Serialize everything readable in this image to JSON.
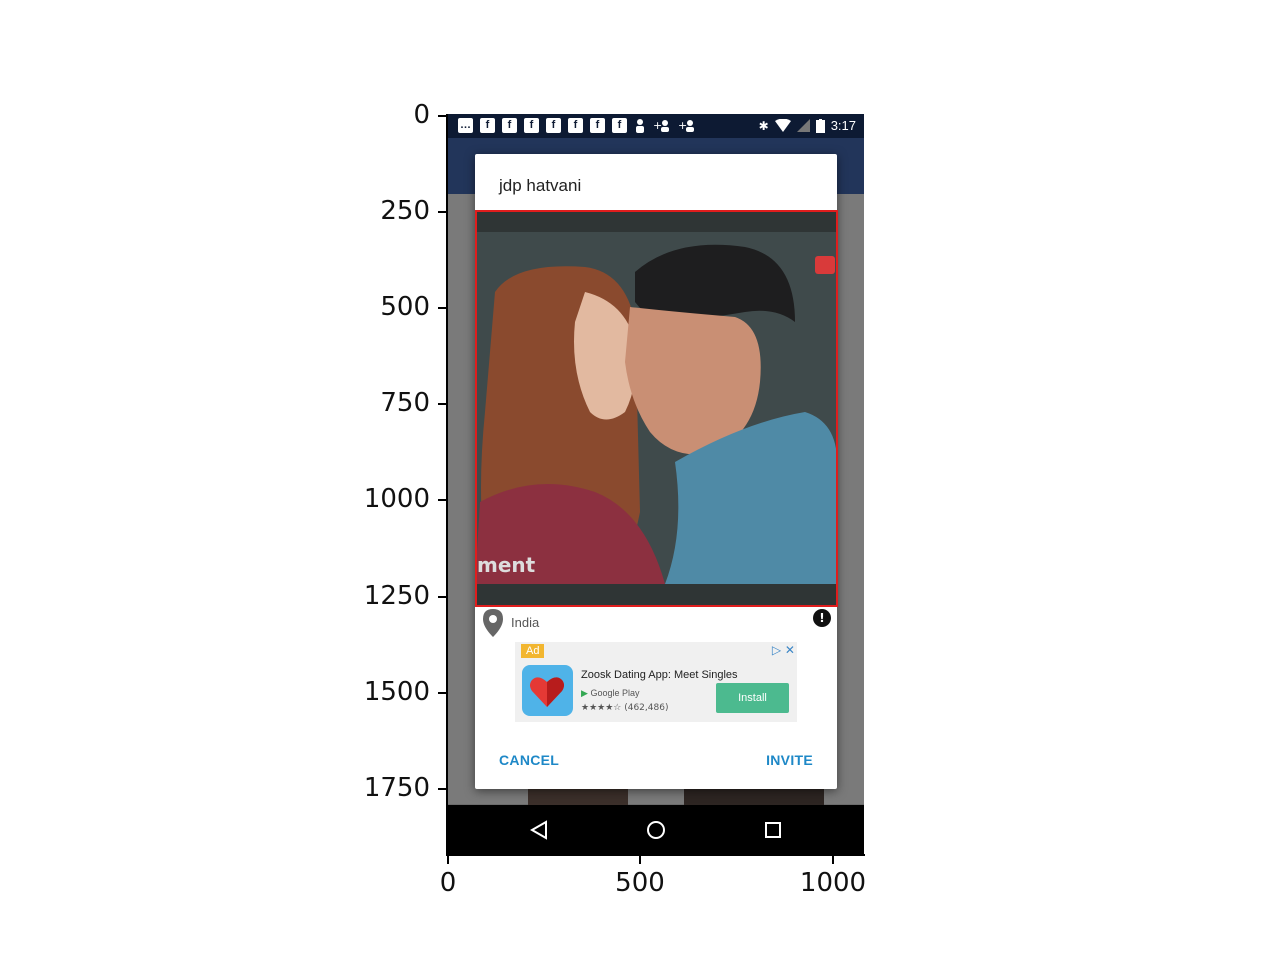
{
  "axes": {
    "y_ticks": [
      "0",
      "250",
      "500",
      "750",
      "1000",
      "1250",
      "1500",
      "1750"
    ],
    "x_ticks": [
      "0",
      "500",
      "1000"
    ]
  },
  "status_bar": {
    "time": "3:17",
    "icons": [
      "message-icon",
      "facebook-icon",
      "facebook-icon",
      "facebook-icon",
      "facebook-icon",
      "facebook-icon",
      "facebook-icon",
      "facebook-icon",
      "person-icon",
      "add-person-icon",
      "add-person-icon",
      "bluetooth-icon",
      "wifi-icon",
      "no-signal-icon",
      "battery-icon"
    ]
  },
  "dialog": {
    "title": "jdp hatvani",
    "photo_caption": "ment",
    "location": "India",
    "cancel_label": "CANCEL",
    "invite_label": "INVITE"
  },
  "ad": {
    "badge": "Ad",
    "title": "Zoosk Dating App: Meet Singles",
    "store": "Google Play",
    "rating_stars": "★★★★☆",
    "rating_count": "(462,486)",
    "install_label": "Install",
    "colors": {
      "badge": "#f2b630",
      "install": "#4cba8f",
      "icon_bg": "#4fb3e8",
      "heart": "#e53935"
    }
  },
  "colors": {
    "status_bar": "#0d1a33",
    "app_bar": "#22355a",
    "highlight_border": "#e01d1d",
    "button_text": "#1e88c7"
  }
}
